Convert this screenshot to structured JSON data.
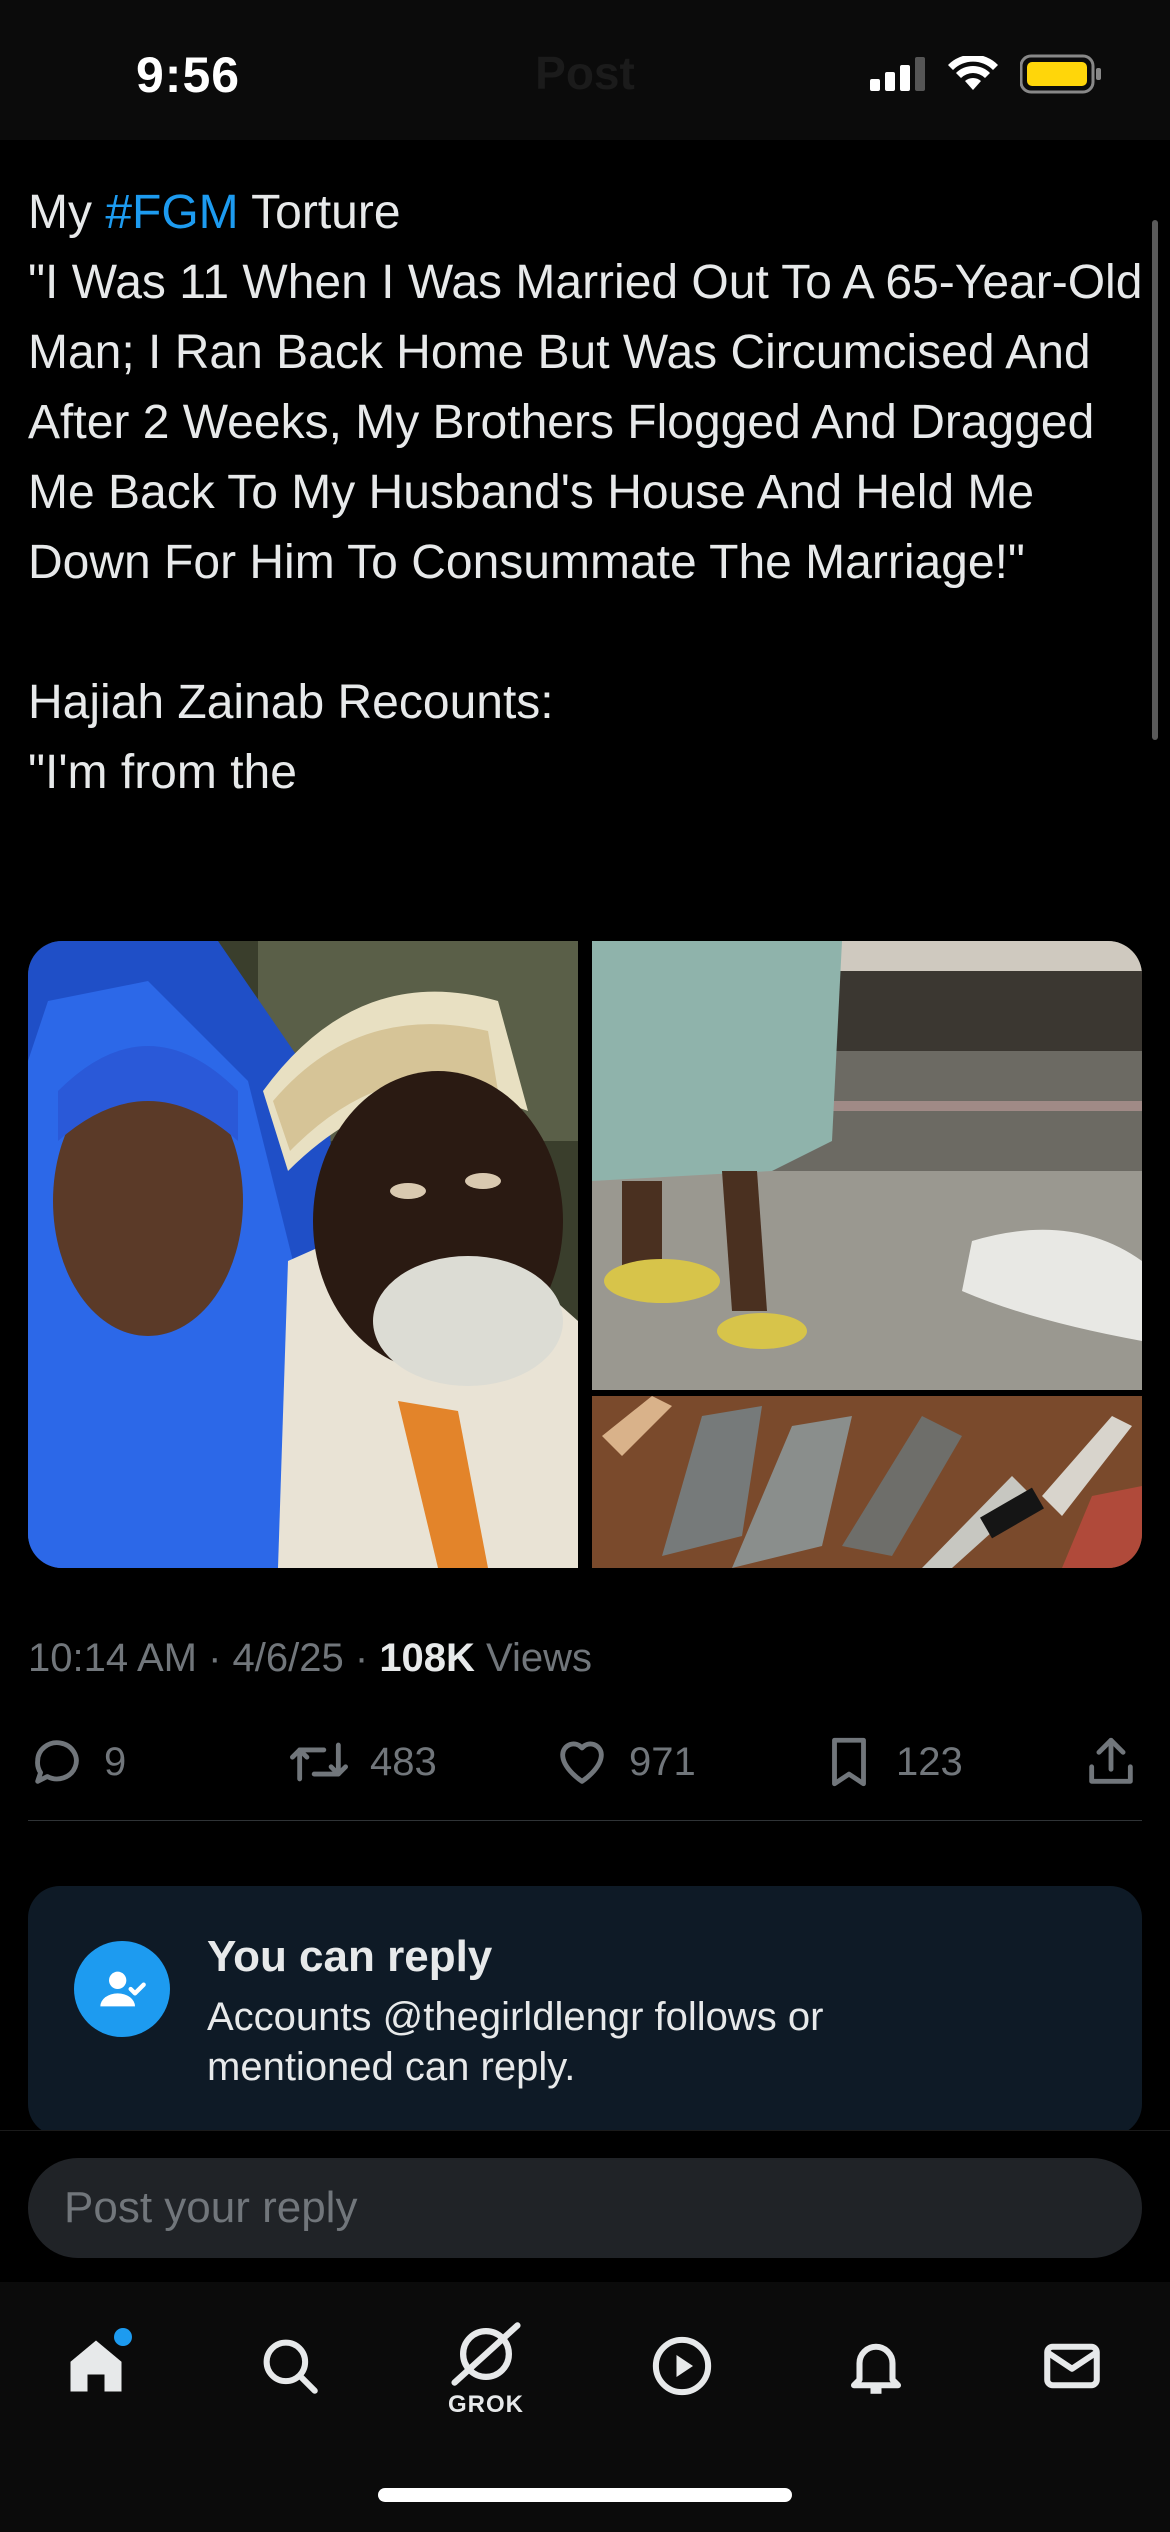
{
  "status_bar": {
    "time": "9:56",
    "battery_color": "#ffd60a"
  },
  "header": {
    "title": "Post"
  },
  "post": {
    "text_prefix": "My ",
    "hashtag": "#FGM",
    "text_body": " Torture\n\"I Was 11 When I Was Married Out To A 65-Year-Old Man; I Ran Back Home But Was Circumcised And After 2 Weeks, My Brothers Flogged And Dragged Me Back To My Husband's House And Held Me Down For Him To Consummate The Marriage!\"\n\nHajiah Zainab Recounts:\n\"I'm from the",
    "timestamp": "10:14 AM · 4/6/25 · ",
    "views_count": "108K",
    "views_label": " Views",
    "accent_color": "#1d9bf0"
  },
  "actions": {
    "replies": "9",
    "reposts": "483",
    "likes": "971",
    "bookmarks": "123"
  },
  "reply_restriction": {
    "title": "You can reply",
    "description": "Accounts @thegirldlengr follows or mentioned can reply."
  },
  "composer": {
    "placeholder": "Post your reply"
  },
  "tabbar": {
    "items": [
      {
        "name": "home-icon",
        "active": true
      },
      {
        "name": "search-icon"
      },
      {
        "name": "grok-icon",
        "label": "GROK"
      },
      {
        "name": "video-icon"
      },
      {
        "name": "notifications-icon"
      },
      {
        "name": "messages-icon"
      }
    ]
  }
}
